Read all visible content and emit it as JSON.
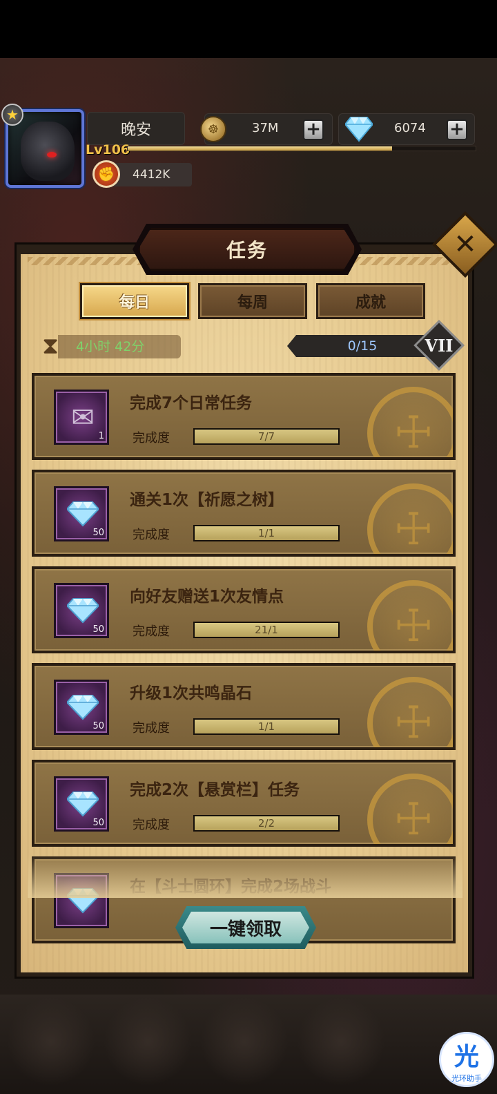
{
  "player": {
    "name": "晚安",
    "level_label": "Lv106",
    "xp_fraction": 0.76,
    "power": "4412K"
  },
  "resources": {
    "gold": "37M",
    "diamonds": "6074",
    "add_label": "+"
  },
  "panel": {
    "title": "任务",
    "close_label": "✕"
  },
  "tabs": [
    {
      "label": "每日",
      "active": true
    },
    {
      "label": "每周",
      "active": false
    },
    {
      "label": "成就",
      "active": false
    }
  ],
  "timer": "4小时 42分",
  "daily_progress": "0/15",
  "rank_badge": "VII",
  "progress_label": "完成度",
  "tasks": [
    {
      "title": "完成7个日常任务",
      "progress": "7/7",
      "fill": 1.0,
      "reward_count": "1",
      "reward_icon": "scroll-icon"
    },
    {
      "title": "通关1次【祈愿之树】",
      "progress": "1/1",
      "fill": 1.0,
      "reward_count": "50",
      "reward_icon": "diamond-icon"
    },
    {
      "title": "向好友赠送1次友情点",
      "progress": "21/1",
      "fill": 1.0,
      "reward_count": "50",
      "reward_icon": "diamond-icon"
    },
    {
      "title": "升级1次共鸣晶石",
      "progress": "1/1",
      "fill": 1.0,
      "reward_count": "50",
      "reward_icon": "diamond-icon"
    },
    {
      "title": "完成2次【悬赏栏】任务",
      "progress": "2/2",
      "fill": 1.0,
      "reward_count": "50",
      "reward_icon": "diamond-icon"
    },
    {
      "title": "在【斗士圆环】完成2场战斗",
      "progress": "",
      "fill": 0,
      "reward_count": "",
      "reward_icon": "diamond-icon"
    }
  ],
  "claim_all_label": "一键领取",
  "helper": {
    "glyph": "光",
    "label": "光环助手"
  },
  "colors": {
    "accent_gold": "#c99a3e",
    "timer_green": "#7fd26a",
    "claim_teal": "#3a8a8a",
    "reward_purple": "#7a3f86"
  }
}
